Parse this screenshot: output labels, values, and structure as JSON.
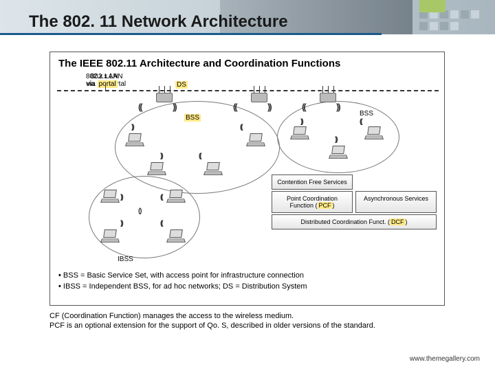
{
  "slide": {
    "title": "The 802. 11 Network Architecture"
  },
  "diagram": {
    "title": "The IEEE 802.11 Architecture and Coordination Functions",
    "lan_label_line1": "802.x LAN",
    "lan_label_line2": "via portal",
    "ds_label": "DS",
    "bss_label_1": "BSS",
    "bss_label_2": "BSS",
    "ibss_label": "IBSS",
    "stack": {
      "cf": "Contention Free Services",
      "pcf": "Point Coordination Function (PCF)",
      "async": "Asynchronous Services",
      "dcf": "Distributed Coordination Funct. (DCF)"
    },
    "bullets": [
      "BSS = Basic Service Set, with access point for infrastructure connection",
      "IBSS = Independent BSS, for ad hoc networks; DS = Distribution System"
    ]
  },
  "caption": {
    "line1": "CF (Coordination Function) manages the access to the wireless medium.",
    "line2": "PCF is an optional extension for the support of Qo. S, described in older versions of the standard."
  },
  "footer": {
    "url": "www.themegallery.com"
  }
}
